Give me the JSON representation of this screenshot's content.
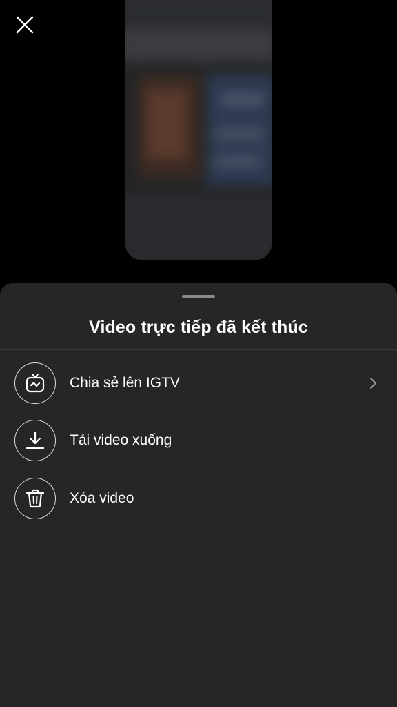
{
  "close": {
    "icon": "close-icon"
  },
  "preview": {
    "icon": "blurred-live-video-thumbnail"
  },
  "sheet": {
    "title": "Video trực tiếp đã kết thúc",
    "items": [
      {
        "label": "Chia sẻ lên IGTV",
        "icon": "igtv-icon",
        "has_chevron": true
      },
      {
        "label": "Tải video xuống",
        "icon": "download-icon",
        "has_chevron": false
      },
      {
        "label": "Xóa video",
        "icon": "trash-icon",
        "has_chevron": false
      }
    ]
  },
  "colors": {
    "background": "#000000",
    "sheet": "#262626",
    "text": "#ffffff",
    "icon_stroke": "#d9d9d9"
  }
}
